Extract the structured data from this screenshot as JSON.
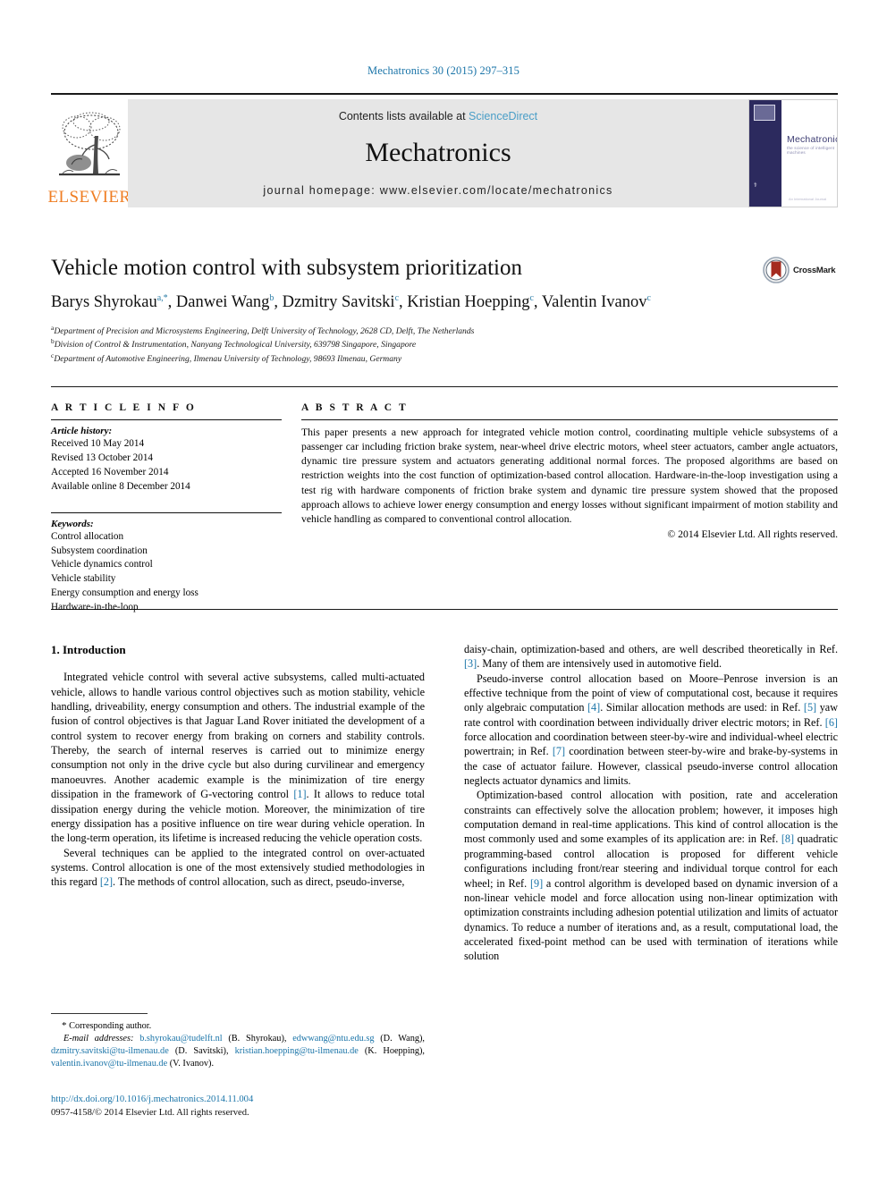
{
  "running_head": "Mechatronics 30 (2015) 297–315",
  "banner": {
    "publisher_logo_text": "ELSEVIER",
    "contents_prefix": "Contents lists available at ",
    "contents_link": "ScienceDirect",
    "journal_name": "Mechatronics",
    "homepage": "journal homepage: www.elsevier.com/locate/mechatronics",
    "cover": {
      "title": "Mechatronics",
      "subtitle": "the science of intelligent machines",
      "footer": "An International Journal"
    }
  },
  "article": {
    "title": "Vehicle motion control with subsystem prioritization",
    "crossmark_label": "CrossMark",
    "authors": [
      {
        "name": "Barys Shyrokau",
        "marks": "a,*"
      },
      {
        "name": "Danwei Wang",
        "marks": "b"
      },
      {
        "name": "Dzmitry Savitski",
        "marks": "c"
      },
      {
        "name": "Kristian Hoepping",
        "marks": "c"
      },
      {
        "name": "Valentin Ivanov",
        "marks": "c"
      }
    ],
    "affiliations": [
      {
        "mark": "a",
        "text": "Department of Precision and Microsystems Engineering, Delft University of Technology, 2628 CD, Delft, The Netherlands"
      },
      {
        "mark": "b",
        "text": "Division of Control & Instrumentation, Nanyang Technological University, 639798 Singapore, Singapore"
      },
      {
        "mark": "c",
        "text": "Department of Automotive Engineering, Ilmenau University of Technology, 98693 Ilmenau, Germany"
      }
    ]
  },
  "article_info": {
    "heading": "A R T I C L E    I N F O",
    "history_label": "Article history:",
    "history": [
      "Received 10 May 2014",
      "Revised 13 October 2014",
      "Accepted 16 November 2014",
      "Available online 8 December 2014"
    ],
    "keywords_label": "Keywords:",
    "keywords": [
      "Control allocation",
      "Subsystem coordination",
      "Vehicle dynamics control",
      "Vehicle stability",
      "Energy consumption and energy loss",
      "Hardware-in-the-loop"
    ]
  },
  "abstract": {
    "heading": "A B S T R A C T",
    "text": "This paper presents a new approach for integrated vehicle motion control, coordinating multiple vehicle subsystems of a passenger car including friction brake system, near-wheel drive electric motors, wheel steer actuators, camber angle actuators, dynamic tire pressure system and actuators generating additional normal forces. The proposed algorithms are based on restriction weights into the cost function of optimization-based control allocation. Hardware-in-the-loop investigation using a test rig with hardware components of friction brake system and dynamic tire pressure system showed that the proposed approach allows to achieve lower energy consumption and energy losses without significant impairment of motion stability and vehicle handling as compared to conventional control allocation.",
    "copyright": "© 2014 Elsevier Ltd. All rights reserved."
  },
  "body": {
    "section_heading": "1. Introduction",
    "left_paragraphs": [
      "Integrated vehicle control with several active subsystems, called multi-actuated vehicle, allows to handle various control objectives such as motion stability, vehicle handling, driveability, energy consumption and others. The industrial example of the fusion of control objectives is that Jaguar Land Rover initiated the development of a control system to recover energy from braking on corners and stability controls. Thereby, the search of internal reserves is carried out to minimize energy consumption not only in the drive cycle but also during curvilinear and emergency manoeuvres. Another academic example is the minimization of tire energy dissipation in the framework of G-vectoring control [1]. It allows to reduce total dissipation energy during the vehicle motion. Moreover, the minimization of tire energy dissipation has a positive influence on tire wear during vehicle operation. In the long-term operation, its lifetime is increased reducing the vehicle operation costs.",
      "Several techniques can be applied to the integrated control on over-actuated systems. Control allocation is one of the most extensively studied methodologies in this regard [2]. The methods of control allocation, such as direct, pseudo-inverse,"
    ],
    "right_paragraphs": [
      "daisy-chain, optimization-based and others, are well described theoretically in Ref. [3]. Many of them are intensively used in automotive field.",
      "Pseudo-inverse control allocation based on Moore–Penrose inversion is an effective technique from the point of view of computational cost, because it requires only algebraic computation [4]. Similar allocation methods are used: in Ref. [5] yaw rate control with coordination between individually driver electric motors; in Ref. [6] force allocation and coordination between steer-by-wire and individual-wheel electric powertrain; in Ref. [7] coordination between steer-by-wire and brake-by-systems in the case of actuator failure. However, classical pseudo-inverse control allocation neglects actuator dynamics and limits.",
      "Optimization-based control allocation with position, rate and acceleration constraints can effectively solve the allocation problem; however, it imposes high computation demand in real-time applications. This kind of control allocation is the most commonly used and some examples of its application are: in Ref. [8] quadratic programming-based control allocation is proposed for different vehicle configurations including front/rear steering and individual torque control for each wheel; in Ref. [9] a control algorithm is developed based on dynamic inversion of a non-linear vehicle model and force allocation using non-linear optimization with optimization constraints including adhesion potential utilization and limits of actuator dynamics. To reduce a number of iterations and, as a result, computational load, the accelerated fixed-point method can be used with termination of iterations while solution"
    ],
    "reference_marks": [
      "1",
      "2",
      "3",
      "4",
      "5",
      "6",
      "7",
      "8",
      "9"
    ]
  },
  "footnote": {
    "corresponding_symbol": "*",
    "corresponding_text": "Corresponding author.",
    "emails_label": "E-mail addresses:",
    "emails": [
      {
        "address": "b.shyrokau@tudelft.nl",
        "owner": "(B. Shyrokau)"
      },
      {
        "address": "edwwang@ntu.edu.sg",
        "owner": "(D. Wang)"
      },
      {
        "address": "dzmitry.savitski@tu-ilmenau.de",
        "owner": "(D. Savitski)"
      },
      {
        "address": "kristian.hoepping@tu-ilmenau.de",
        "owner": "(K. Hoepping)"
      },
      {
        "address": "valentin.ivanov@tu-ilmenau.de",
        "owner": "(V. Ivanov)"
      }
    ],
    "doi": "http://dx.doi.org/10.1016/j.mechatronics.2014.11.004",
    "issn": "0957-4158/© 2014 Elsevier Ltd. All rights reserved."
  },
  "colors": {
    "link": "#1a74a8",
    "sciencedirect": "#4a9ec7",
    "elsevier_orange": "#ef7d22",
    "banner_grey": "#e6e6e6",
    "cover_navy": "#2c2a5e"
  }
}
